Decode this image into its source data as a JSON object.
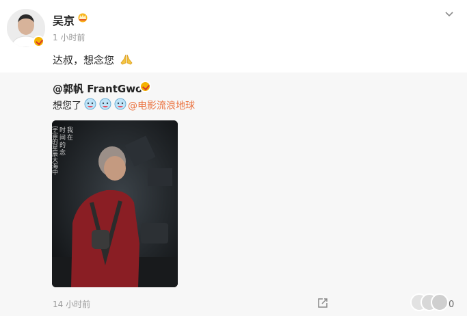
{
  "post": {
    "author": "吴京",
    "time": "1 小时前",
    "text": "达叔，想念您",
    "icons": {
      "crown": "crown-icon",
      "verified": "verified-badge-icon",
      "pray": "pray-icon",
      "more": "chevron-down-icon"
    }
  },
  "repost": {
    "author": "@郭帆 FrantGwo",
    "text": "想您了",
    "link": "@电影流浪地球",
    "time": "14 小时前",
    "count": "0",
    "poster_text": [
      "我在",
      "时间的念",
      "宇宙的星辰大海中"
    ],
    "colors": {
      "link": "#eb7340",
      "background": "#f7f7f7"
    }
  }
}
